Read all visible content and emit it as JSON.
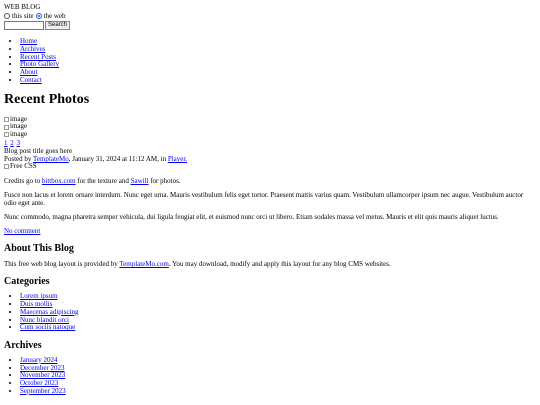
{
  "header": {
    "site_title": "WEB BLOG"
  },
  "search": {
    "option_this_site": "this site",
    "option_the_web": "the web",
    "selected": "the web",
    "input_value": "",
    "button_label": "Search"
  },
  "nav": {
    "items": [
      {
        "label": "Home"
      },
      {
        "label": "Archives"
      },
      {
        "label": "Recent Posts"
      },
      {
        "label": "Photo Gallery"
      },
      {
        "label": "About"
      },
      {
        "label": "Contact"
      }
    ]
  },
  "recent_photos": {
    "title": "Recent Photos",
    "images": [
      {
        "alt": "image"
      },
      {
        "alt": "image"
      },
      {
        "alt": "image"
      }
    ],
    "pages": [
      "1",
      "2",
      "3"
    ]
  },
  "post": {
    "title": "Blog post title goes here",
    "posted_by_prefix": "Posted by",
    "author": "TemplateMo",
    "date_text": ", January 31, 2024 at 11:12 AM, in",
    "category": "Player.",
    "image_alt": "Free CSS",
    "credits": {
      "prefix": "Credits go to",
      "link1": "bittbox.com",
      "middle": "for the texture and",
      "link2": "Sawill",
      "suffix": "for photos."
    },
    "paragraph1": "Fusce non lacus et lorem ornare interdum. Nunc eget urna. Mauris vestibulum felis eget tortor. Praesent mattis varius quam. Vestibulum ullamcorper ipsum nec augue. Vestibulum auctor odio eget ante.",
    "paragraph2": "Nunc commodo, magna pharetra semper vehicula, dui ligula feugiat elit, et euismod nunc orci ut libero. Etiam sodales massa vel metus. Mauris et elit quis mauris aliquet luctus.",
    "comment_link": "No comment"
  },
  "about": {
    "title": "About This Blog",
    "text_prefix": "This free web blog layout is provided by",
    "link": "TemplateMo.com",
    "text_suffix": ". You may download, modify and apply this layout for any blog CMS websites."
  },
  "categories": {
    "title": "Categories",
    "items": [
      {
        "label": "Lorem ipsum"
      },
      {
        "label": "Duis mollis"
      },
      {
        "label": "Maecenas adipiscing"
      },
      {
        "label": "Nunc blandit orci"
      },
      {
        "label": "Cum sociis natoque"
      }
    ]
  },
  "archives": {
    "title": "Archives",
    "items": [
      {
        "label": "January 2024"
      },
      {
        "label": "December 2023"
      },
      {
        "label": "November 2023"
      },
      {
        "label": "October 2023"
      },
      {
        "label": "September 2023"
      }
    ]
  }
}
